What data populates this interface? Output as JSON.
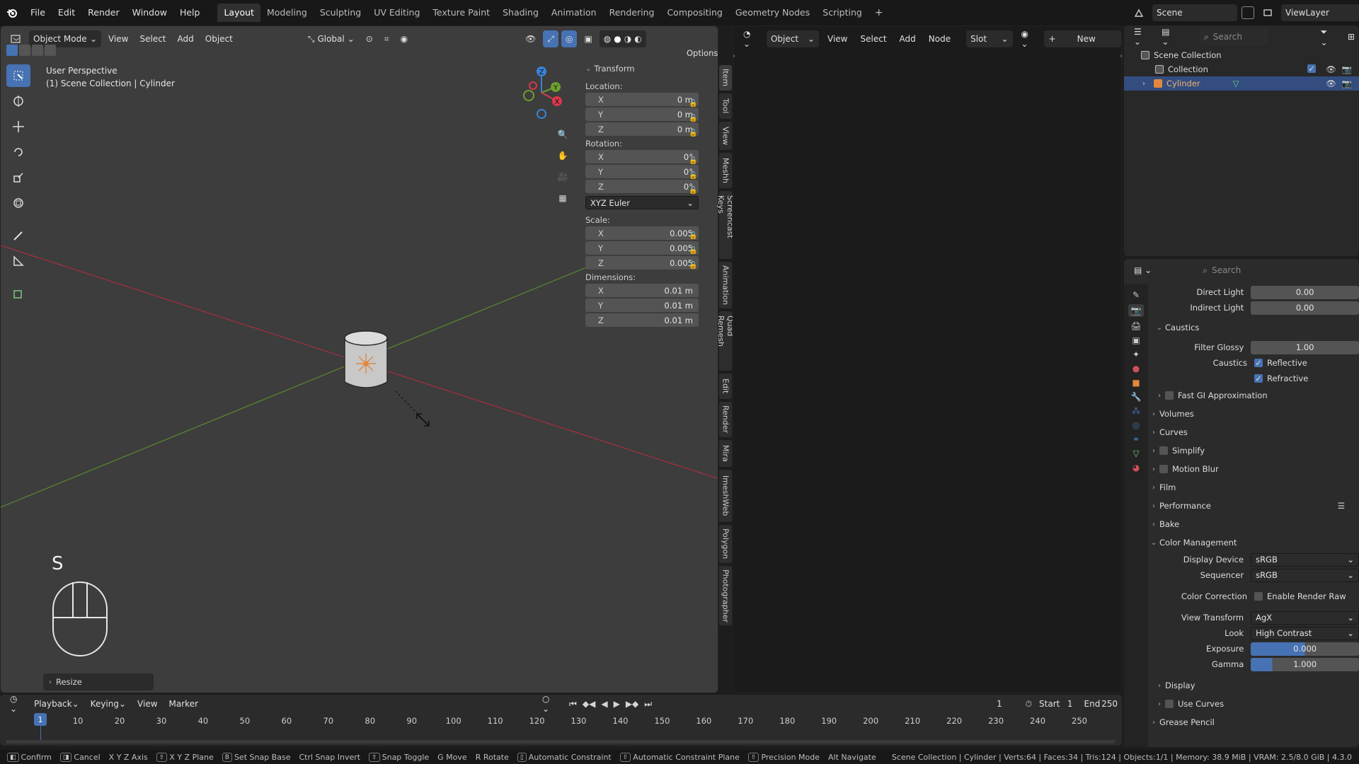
{
  "menus": [
    "File",
    "Edit",
    "Render",
    "Window",
    "Help"
  ],
  "workspaces": [
    "Layout",
    "Modeling",
    "Sculpting",
    "UV Editing",
    "Texture Paint",
    "Shading",
    "Animation",
    "Rendering",
    "Compositing",
    "Geometry Nodes",
    "Scripting"
  ],
  "active_workspace": "Layout",
  "scene": {
    "label": "Scene",
    "viewlayer": "ViewLayer"
  },
  "viewport": {
    "mode": "Object Mode",
    "menu": [
      "View",
      "Select",
      "Add",
      "Object"
    ],
    "orientation": "Global",
    "options": "Options",
    "overlay_title": "User Perspective",
    "overlay_sub": "(1) Scene Collection | Cylinder",
    "key_display": "S",
    "operator_panel": "Resize",
    "gizmo_axes": [
      "Z",
      "Y",
      "X"
    ],
    "side_tabs": [
      "Item",
      "Tool",
      "View",
      "Meshh",
      "Screencast Keys",
      "Animation",
      "Quad Remesh",
      "Edit",
      "Render",
      "Mira",
      "ImeshWeb",
      "Polygon",
      "Photographer"
    ]
  },
  "transform": {
    "title": "Transform",
    "location_label": "Location:",
    "location": [
      {
        "axis": "X",
        "value": "0 m"
      },
      {
        "axis": "Y",
        "value": "0 m"
      },
      {
        "axis": "Z",
        "value": "0 m"
      }
    ],
    "rotation_label": "Rotation:",
    "rotation": [
      {
        "axis": "X",
        "value": "0°"
      },
      {
        "axis": "Y",
        "value": "0°"
      },
      {
        "axis": "Z",
        "value": "0°"
      }
    ],
    "rotation_mode": "XYZ Euler",
    "scale_label": "Scale:",
    "scale": [
      {
        "axis": "X",
        "value": "0.005"
      },
      {
        "axis": "Y",
        "value": "0.005"
      },
      {
        "axis": "Z",
        "value": "0.005"
      }
    ],
    "dimensions_label": "Dimensions:",
    "dimensions": [
      {
        "axis": "X",
        "value": "0.01 m"
      },
      {
        "axis": "Y",
        "value": "0.01 m"
      },
      {
        "axis": "Z",
        "value": "0.01 m"
      }
    ]
  },
  "editor2": {
    "object": "Object",
    "menu": [
      "View",
      "Select",
      "Add",
      "Node"
    ],
    "slot": "Slot",
    "new": "New"
  },
  "outliner": {
    "search_placeholder": "Search",
    "rows": [
      "Scene Collection",
      "Collection",
      "Cylinder"
    ]
  },
  "properties": {
    "search_placeholder": "Search",
    "direct_light_label": "Direct Light",
    "direct_light": "0.00",
    "indirect_light_label": "Indirect Light",
    "indirect_light": "0.00",
    "caustics_header": "Caustics",
    "filter_glossy_label": "Filter Glossy",
    "filter_glossy": "1.00",
    "caustics_label": "Caustics",
    "reflective": "Reflective",
    "refractive": "Refractive",
    "fast_gi": "Fast GI Approximation",
    "sections": [
      "Volumes",
      "Curves",
      "Simplify",
      "Motion Blur",
      "Film",
      "Performance",
      "Bake"
    ],
    "color_management": "Color Management",
    "display_device_label": "Display Device",
    "display_device": "sRGB",
    "sequencer_label": "Sequencer",
    "sequencer": "sRGB",
    "color_correction_label": "Color Correction",
    "enable_render_raw": "Enable Render Raw",
    "view_transform_label": "View Transform",
    "view_transform": "AgX",
    "look_label": "Look",
    "look": "High Contrast",
    "exposure_label": "Exposure",
    "exposure": "0.000",
    "gamma_label": "Gamma",
    "gamma": "1.000",
    "display": "Display",
    "use_curves": "Use Curves",
    "grease_pencil": "Grease Pencil"
  },
  "timeline": {
    "menu": [
      "Playback",
      "Keying",
      "View",
      "Marker"
    ],
    "current_frame": "1",
    "start_label": "Start",
    "start": "1",
    "end_label": "End",
    "end": "250",
    "ticks": [
      "1",
      "10",
      "20",
      "30",
      "40",
      "50",
      "60",
      "70",
      "80",
      "90",
      "100",
      "110",
      "120",
      "130",
      "140",
      "150",
      "160",
      "170",
      "180",
      "190",
      "200",
      "210",
      "220",
      "230",
      "240",
      "250"
    ]
  },
  "status": {
    "items": [
      "Confirm",
      "Cancel",
      "X Y Z Axis",
      "X Y Z Plane",
      "Set Snap Base",
      "Ctrl Snap Invert",
      "Snap Toggle",
      "G Move",
      "R Rotate",
      "Automatic Constraint",
      "Automatic Constraint Plane",
      "Precision Mode",
      "Alt Navigate"
    ],
    "stats": "Scene Collection | Cylinder | Verts:64 | Faces:34 | Tris:124 | Objects:1/1 | Memory: 38.9 MiB | VRAM: 2.5/8.0 GiB | 4.3.0"
  },
  "colors": {
    "accent": "#4772b3",
    "x_axis": "#d8384b",
    "y_axis": "#6ea02f",
    "z_axis": "#3b82d6"
  }
}
